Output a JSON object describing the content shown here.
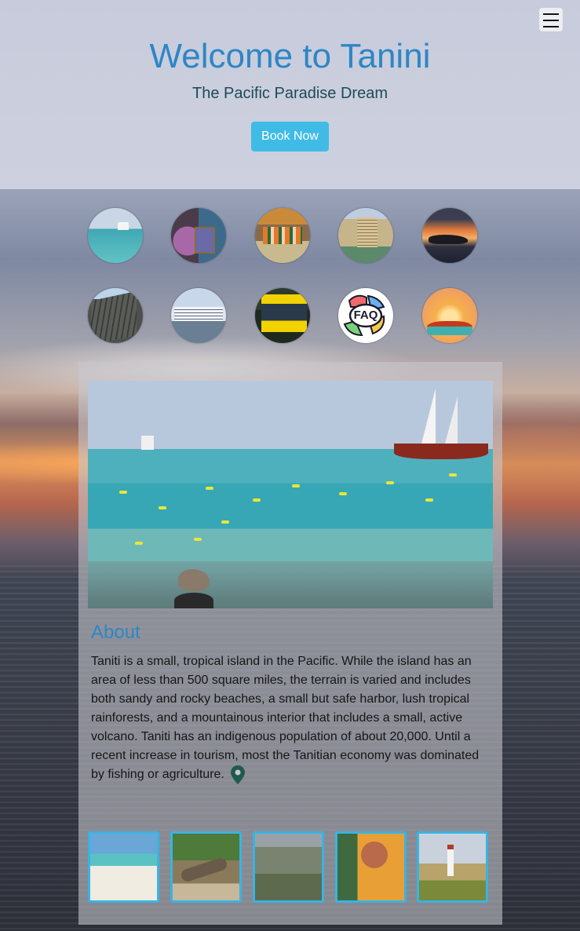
{
  "header": {
    "title": "Welcome to Tanini",
    "subtitle": "The Pacific Paradise Dream",
    "book_button": "Book Now",
    "menu_icon": "hamburger-menu-icon"
  },
  "nav_thumbnails": [
    {
      "name": "beach-sailboat"
    },
    {
      "name": "flower-shop"
    },
    {
      "name": "market-stalls"
    },
    {
      "name": "hotel"
    },
    {
      "name": "helicopter-sunset"
    },
    {
      "name": "fortress-wall"
    },
    {
      "name": "cruise-ship"
    },
    {
      "name": "bus"
    },
    {
      "name": "faq",
      "label": "FAQ"
    },
    {
      "name": "sunset-chat"
    }
  ],
  "about": {
    "title": "About",
    "text": "Taniti is a small, tropical island in the Pacific. While the island has an area of less than 500 square miles, the terrain is varied and includes both sandy and rocky beaches, a small but safe harbor, lush tropical rainforests, and a mountainous interior that includes a small, active volcano. Taniti has an indigenous population of about 20,000. Until a recent increase in tourism, most the Tanitian economy was dominated by fishing or agriculture.",
    "pin_icon": "map-pin-icon"
  },
  "gallery": [
    {
      "name": "sandy-beach"
    },
    {
      "name": "driftwood-rainforest"
    },
    {
      "name": "mountain-valley"
    },
    {
      "name": "dancers"
    },
    {
      "name": "lighthouse"
    }
  ],
  "colors": {
    "title": "#2e86c6",
    "subtitle": "#1e4a5a",
    "button": "#3fbbe6",
    "gallery_border": "#38b4e4",
    "pin": "#1e5a4e"
  }
}
